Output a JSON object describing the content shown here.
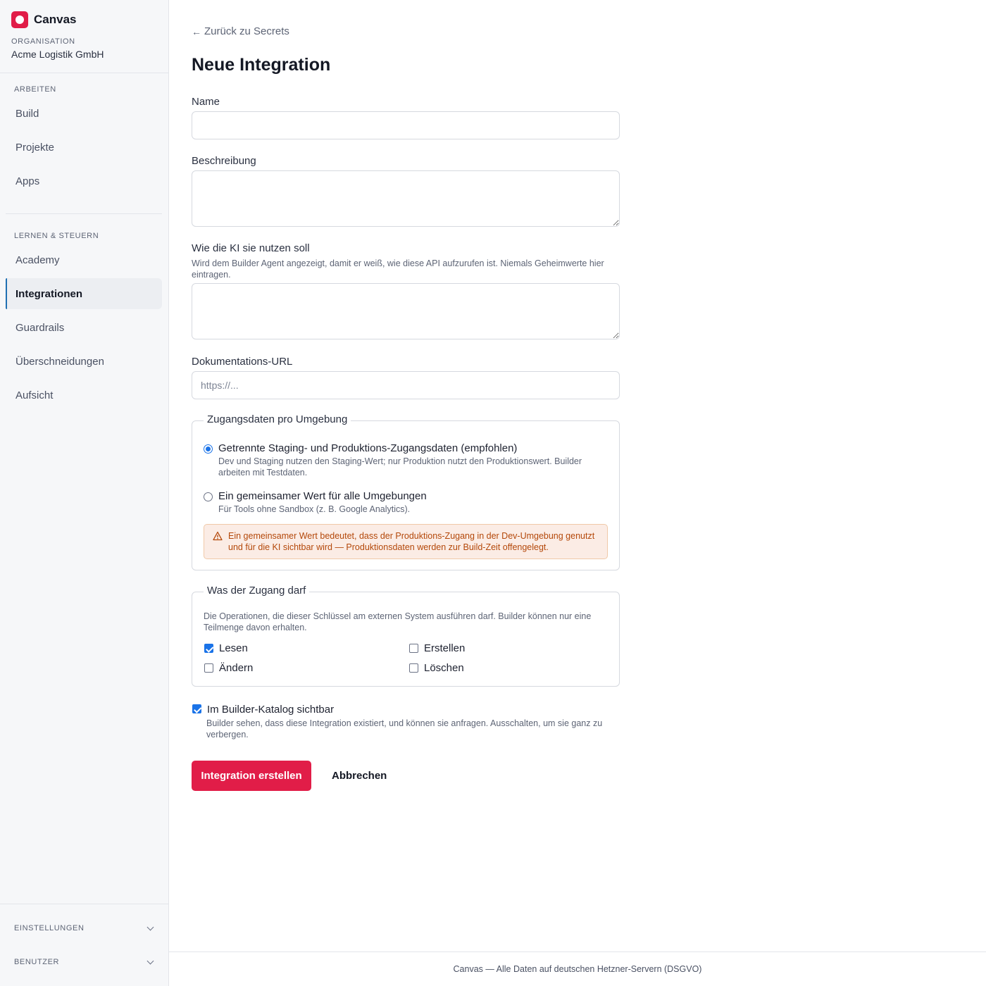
{
  "brand": {
    "name": "Canvas"
  },
  "organization": {
    "label": "ORGANISATION",
    "name": "Acme Logistik GmbH"
  },
  "sidebar": {
    "sections": [
      {
        "label": "ARBEITEN",
        "items": [
          "Build",
          "Projekte",
          "Apps"
        ]
      },
      {
        "label": "LERNEN & STEUERN",
        "items": [
          "Academy",
          "Integrationen",
          "Guardrails",
          "Überschneidungen",
          "Aufsicht"
        ]
      }
    ],
    "active_item": "Integrationen",
    "footer": [
      "EINSTELLUNGEN",
      "BENUTZER"
    ]
  },
  "main": {
    "back_link": "Zurück zu Secrets",
    "back_arrow": "←",
    "title": "Neue Integration",
    "fields": {
      "name": {
        "label": "Name",
        "value": ""
      },
      "description": {
        "label": "Beschreibung",
        "value": ""
      },
      "ai_usage": {
        "label": "Wie die KI sie nutzen soll",
        "hint": "Wird dem Builder Agent angezeigt, damit er weiß, wie diese API aufzurufen ist. Niemals Geheimwerte hier eintragen.",
        "value": ""
      },
      "docs_url": {
        "label": "Dokumentations-URL",
        "placeholder": "https://...",
        "value": ""
      }
    },
    "credentials": {
      "legend": "Zugangsdaten pro Umgebung",
      "options": [
        {
          "title": "Getrennte Staging- und Produktions-Zugangsdaten (empfohlen)",
          "description": "Dev und Staging nutzen den Staging-Wert; nur Produktion nutzt den Produktionswert. Builder arbeiten mit Testdaten.",
          "selected": true
        },
        {
          "title": "Ein gemeinsamer Wert für alle Umgebungen",
          "description": "Für Tools ohne Sandbox (z. B. Google Analytics).",
          "selected": false
        }
      ],
      "warning": "Ein gemeinsamer Wert bedeutet, dass der Produktions-Zugang in der Dev-Umgebung genutzt und für die KI sichtbar wird — Produktionsdaten werden zur Build-Zeit offengelegt.",
      "warning_icon": "warning-triangle-icon"
    },
    "permissions": {
      "legend": "Was der Zugang darf",
      "description": "Die Operationen, die dieser Schlüssel am externen System ausführen darf. Builder können nur eine Teilmenge davon erhalten.",
      "items": [
        {
          "label": "Lesen",
          "checked": true
        },
        {
          "label": "Erstellen",
          "checked": false
        },
        {
          "label": "Ändern",
          "checked": false
        },
        {
          "label": "Löschen",
          "checked": false
        }
      ]
    },
    "catalog": {
      "label": "Im Builder-Katalog sichtbar",
      "description": "Builder sehen, dass diese Integration existiert, und können sie anfragen. Ausschalten, um sie ganz zu verbergen.",
      "checked": true
    },
    "actions": {
      "submit": "Integration erstellen",
      "cancel": "Abbrechen"
    }
  },
  "footer": {
    "text": "Canvas — Alle Daten auf deutschen Hetzner-Servern (DSGVO)"
  },
  "colors": {
    "accent": "#e11d48",
    "active_border": "#1f6fb2",
    "checkbox": "#1a73e8",
    "warning_text": "#b4480a",
    "warning_bg": "#fbece5"
  }
}
